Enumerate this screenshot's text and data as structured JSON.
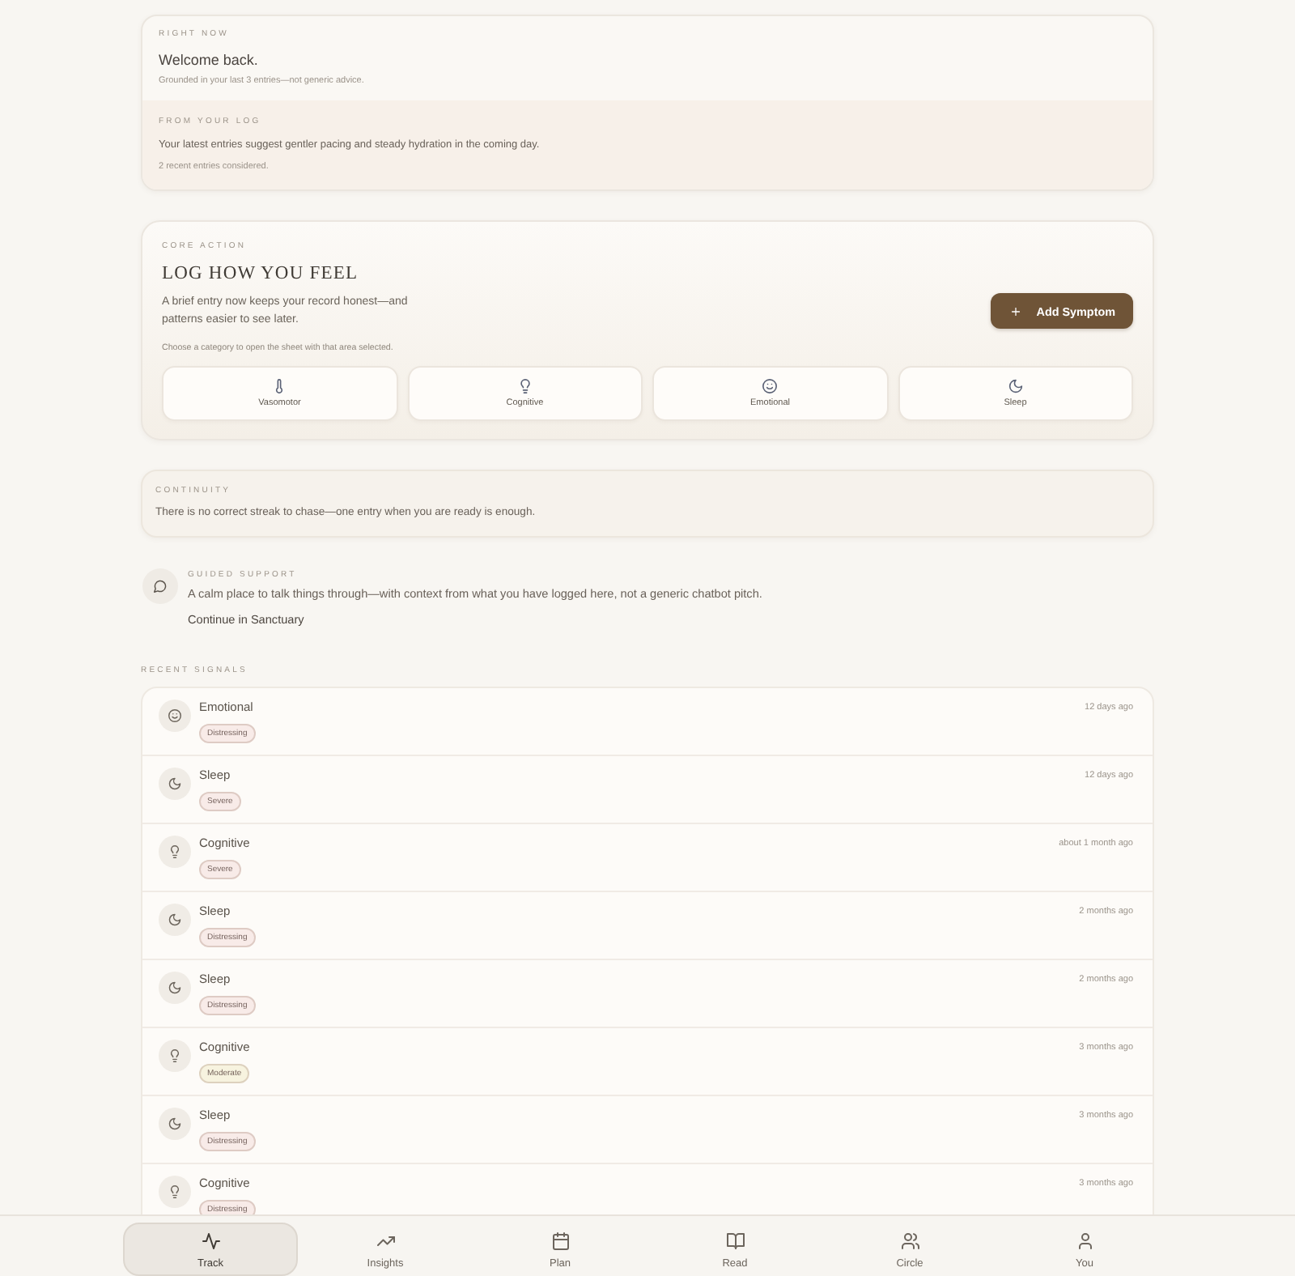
{
  "right_now": {
    "label": "RIGHT NOW",
    "heading": "Welcome back.",
    "note": "Grounded in your last 3 entries—not generic advice."
  },
  "from_your_log": {
    "label": "FROM YOUR LOG",
    "text": "Your latest entries suggest gentler pacing and steady hydration in the coming day.",
    "note": "2 recent entries considered."
  },
  "core_action": {
    "label": "CORE ACTION",
    "title": "LOG HOW YOU FEEL",
    "description": "A brief entry now keeps your record honest—and patterns easier to see later.",
    "button": "Add Symptom",
    "hint": "Choose a category to open the sheet with that area selected.",
    "categories": [
      {
        "kind": "vasomotor",
        "label": "Vasomotor"
      },
      {
        "kind": "cognitive",
        "label": "Cognitive"
      },
      {
        "kind": "emotional",
        "label": "Emotional"
      },
      {
        "kind": "sleep",
        "label": "Sleep"
      }
    ]
  },
  "continuity": {
    "label": "CONTINUITY",
    "text": "There is no correct streak to chase—one entry when you are ready is enough."
  },
  "guided_support": {
    "label": "GUIDED SUPPORT",
    "text": "A calm place to talk things through—with context from what you have logged here, not a generic chatbot pitch.",
    "link": "Continue in Sanctuary"
  },
  "recent_signals": {
    "label": "RECENT SIGNALS",
    "entries": [
      {
        "kind": "emotional",
        "title": "Emotional",
        "tag": {
          "label": "Distressing",
          "color": "#f8ebe8"
        },
        "time": "12 days ago"
      },
      {
        "kind": "sleep",
        "title": "Sleep",
        "tag": {
          "label": "Severe",
          "color": "#f8ebe8"
        },
        "time": "12 days ago"
      },
      {
        "kind": "cognitive",
        "title": "Cognitive",
        "tag": {
          "label": "Severe",
          "color": "#f8ebe8"
        },
        "time": "about 1 month ago"
      },
      {
        "kind": "sleep",
        "title": "Sleep",
        "tag": {
          "label": "Distressing",
          "color": "#f8ebe8"
        },
        "time": "2 months ago"
      },
      {
        "kind": "sleep",
        "title": "Sleep",
        "tag": {
          "label": "Distressing",
          "color": "#f8ebe8"
        },
        "time": "2 months ago"
      },
      {
        "kind": "cognitive",
        "title": "Cognitive",
        "tag": {
          "label": "Moderate",
          "color": "#f7f3df"
        },
        "time": "3 months ago"
      },
      {
        "kind": "sleep",
        "title": "Sleep",
        "tag": {
          "label": "Distressing",
          "color": "#f8ebe8"
        },
        "time": "3 months ago"
      },
      {
        "kind": "cognitive",
        "title": "Cognitive",
        "tag": {
          "label": "Distressing",
          "color": "#f8ebe8"
        },
        "time": "3 months ago"
      }
    ]
  },
  "nav": {
    "tabs": [
      {
        "kind": "track",
        "label": "Track",
        "selected": true
      },
      {
        "kind": "insights",
        "label": "Insights",
        "selected": false
      },
      {
        "kind": "plan",
        "label": "Plan",
        "selected": false
      },
      {
        "kind": "read",
        "label": "Read",
        "selected": false
      },
      {
        "kind": "circle",
        "label": "Circle",
        "selected": false
      },
      {
        "kind": "you",
        "label": "You",
        "selected": false
      }
    ]
  }
}
